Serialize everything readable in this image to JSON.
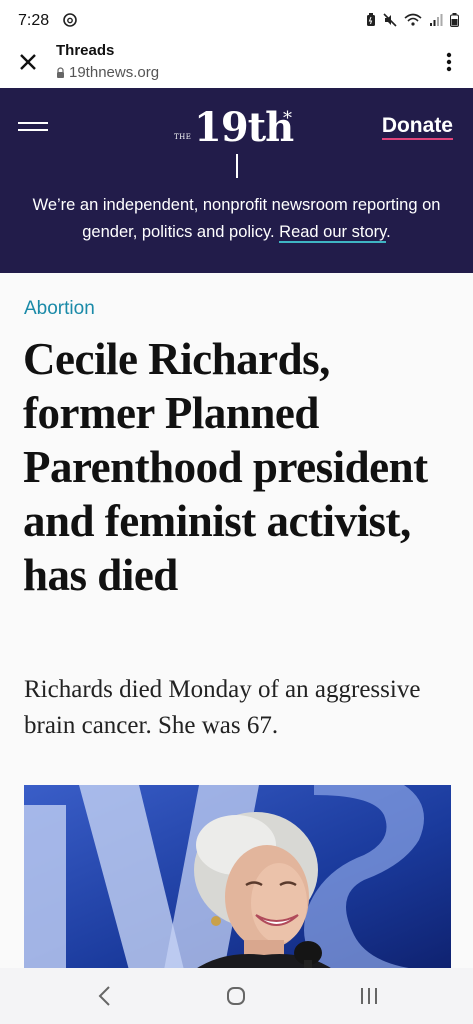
{
  "status_bar": {
    "time": "7:28",
    "icons": [
      "threads-icon",
      "battery-saver-icon",
      "mute-icon",
      "wifi-icon",
      "signal-icon",
      "battery-icon"
    ]
  },
  "browser": {
    "page_title": "Threads",
    "url": "19thnews.org",
    "icons": [
      "close-icon",
      "lock-icon",
      "more-vert-icon"
    ]
  },
  "site_header": {
    "logo_prefix": "THE",
    "logo_main": "19th",
    "logo_mark": "*",
    "donate_label": "Donate",
    "mission_text": "We’re an independent, nonprofit newsroom reporting on gender, politics and policy. ",
    "mission_link": "Read our story",
    "mission_end": ".",
    "colors": {
      "header_bg": "#221c4a",
      "donate_underline": "#e0457b",
      "link_underline": "#3fb5c4"
    }
  },
  "article": {
    "category": "Abortion",
    "headline": "Cecile Richards, former Planned Parenthood president and feminist activist, has died",
    "dek": "Richards died Monday of an aggressive brain cancer. She was 67.",
    "colors": {
      "category": "#1a8aa8"
    }
  },
  "nav_bar": {
    "icons": [
      "back-icon",
      "home-icon",
      "recents-icon"
    ]
  }
}
